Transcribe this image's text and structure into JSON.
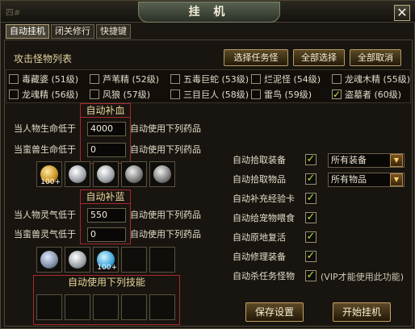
{
  "window": {
    "title": "挂 机",
    "corner_label": "四#"
  },
  "tabs": [
    {
      "label": "自动挂机"
    },
    {
      "label": "闭关修行"
    },
    {
      "label": "快捷键"
    }
  ],
  "monster_section": {
    "title": "攻击怪物列表",
    "buttons": {
      "select_task": "选择任务怪",
      "select_all": "全部选择",
      "cancel_all": "全部取消"
    }
  },
  "monsters": [
    {
      "label": "毒藏婆 (51级)",
      "checked": false
    },
    {
      "label": "芦苇精 (52级)",
      "checked": false
    },
    {
      "label": "五毒巨蛇 (53级)",
      "checked": false
    },
    {
      "label": "烂泥怪 (54级)",
      "checked": false
    },
    {
      "label": "龙魂木精 (55级)",
      "checked": false
    },
    {
      "label": "龙魂精 (56级)",
      "checked": false
    },
    {
      "label": "风狼 (57级)",
      "checked": false
    },
    {
      "label": "三目巨人 (58级)",
      "checked": false
    },
    {
      "label": "雷鸟 (59级)",
      "checked": false
    },
    {
      "label": "盗墓者 (60级)",
      "checked": true
    }
  ],
  "hp": {
    "title": "自动补血",
    "rows": [
      {
        "label": "当人物生命低于",
        "value": "4000",
        "suffix": "自动使用下列药品"
      },
      {
        "label": "当蛮兽生命低于",
        "value": "0",
        "suffix": "自动使用下列药品"
      }
    ],
    "slot_counts": [
      "100+"
    ]
  },
  "mp": {
    "title": "自动补蓝",
    "rows": [
      {
        "label": "当人物灵气低于",
        "value": "550",
        "suffix": "自动使用下列药品"
      },
      {
        "label": "当蛮兽灵气低于",
        "value": "0",
        "suffix": "自动使用下列药品"
      }
    ],
    "slot_counts": [
      "100+"
    ]
  },
  "skills": {
    "title": "自动使用下列技能"
  },
  "options": [
    {
      "label": "自动拾取装备",
      "checked": true,
      "dropdown": "所有装备"
    },
    {
      "label": "自动拾取物品",
      "checked": true,
      "dropdown": "所有物品"
    },
    {
      "label": "自动补充经验卡",
      "checked": true
    },
    {
      "label": "自动给宠物喂食",
      "checked": true
    },
    {
      "label": "自动原地复活",
      "checked": true
    },
    {
      "label": "自动修理装备",
      "checked": true
    },
    {
      "label": "自动杀任务怪物",
      "checked": true,
      "note": "(VIP才能使用此功能)"
    }
  ],
  "footer": {
    "save": "保存设置",
    "start": "开始挂机"
  },
  "colors": {
    "check": "#b7e33a",
    "red_border": "#a9282e"
  },
  "icons": [
    "close-icon",
    "check-icon",
    "dropdown-arrow-icon",
    "potion-icon"
  ]
}
